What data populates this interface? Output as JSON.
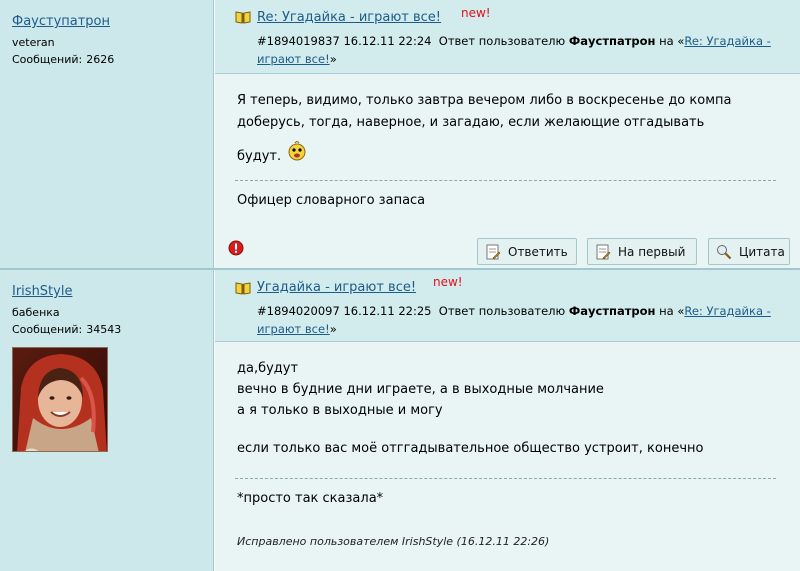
{
  "posts": [
    {
      "author": {
        "name": "Фауступатрон",
        "rank": "veteran",
        "messages_label": "Сообщений:",
        "messages_count": "2626"
      },
      "title": "Re: Угадайка - играют все!",
      "new_badge": "new!",
      "meta": {
        "id_date": "#1894019837 16.12.11 22:24",
        "reply_prefix": "Ответ пользователю",
        "reply_to_user": "Фаустпатрон",
        "reply_on": "на «",
        "reply_link": "Re: Угадайка - играют все!",
        "reply_close": "»"
      },
      "body_lines": [
        "Я теперь, видимо, только завтра вечером либо в воскресенье до компа",
        "доберусь, тогда, наверное, и загадаю, если желающие отгадывать",
        "будут."
      ],
      "signature": "Офицер словарного запаса",
      "buttons": {
        "reply": "Ответить",
        "first": "На первый",
        "quote": "Цитата"
      }
    },
    {
      "author": {
        "name": "IrishStyle",
        "rank": "бабенка",
        "messages_label": "Сообщений:",
        "messages_count": "34543"
      },
      "title": "Угадайка - играют все!",
      "new_badge": "new!",
      "meta": {
        "id_date": "#1894020097 16.12.11 22:25",
        "reply_prefix": "Ответ пользователю",
        "reply_to_user": "Фаустпатрон",
        "reply_on": "на «",
        "reply_link": "Re: Угадайка - играют все!",
        "reply_close": "»"
      },
      "body_lines": [
        "да,будут",
        "вечно в будние дни играете, а в выходные молчание",
        "а я только в выходные и могу",
        "",
        "если только вас моё отггадывательное общество устроит, конечно"
      ],
      "signature": "*просто так сказала*",
      "edited": "Исправлено пользователем IrishStyle (16.12.11 22:26)"
    }
  ],
  "colors": {
    "author_bg": "#cde8ea",
    "content_bg": "#e9f5f5",
    "head_bg": "#d2ebec",
    "link": "#1d5c8a",
    "new": "#e0101a"
  }
}
